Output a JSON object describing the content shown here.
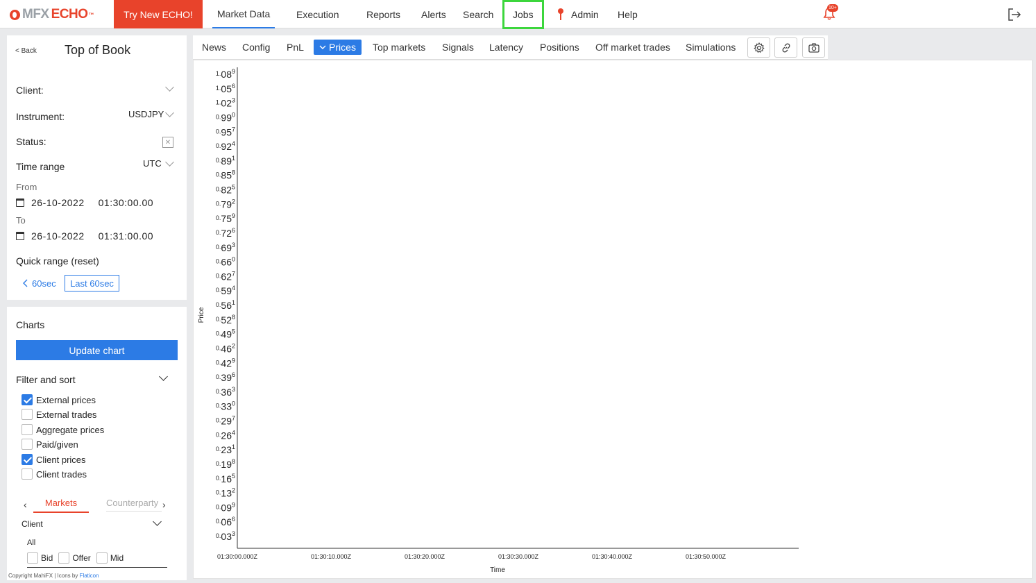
{
  "topbar": {
    "logo_mfx": "MFX",
    "logo_echo": "ECHO",
    "logo_tm": "™",
    "try_label": "Try New ECHO!",
    "nav": [
      "Market Data",
      "Execution",
      "Reports",
      "Alerts",
      "Search",
      "Jobs",
      "Admin",
      "Help"
    ],
    "notification_badge": "10+"
  },
  "left": {
    "back_label": "Back",
    "title": "Top of Book",
    "client_label": "Client:",
    "instrument_label": "Instrument:",
    "instrument_value": "USDJPY",
    "status_label": "Status:",
    "time_range_label": "Time range",
    "time_zone": "UTC",
    "from_label": "From",
    "from_date": "26-10-2022",
    "from_time": "01:30:00.00",
    "to_label": "To",
    "to_date": "26-10-2022",
    "to_time": "01:31:00.00",
    "quick_range_label": "Quick range (reset)",
    "prev_range": "60sec",
    "last_range": "Last 60sec",
    "charts_label": "Charts",
    "update_label": "Update chart",
    "filter_label": "Filter and sort",
    "filters": [
      {
        "label": "External prices",
        "checked": true
      },
      {
        "label": "External trades",
        "checked": false
      },
      {
        "label": "Aggregate prices",
        "checked": false
      },
      {
        "label": "Paid/given",
        "checked": false
      },
      {
        "label": "Client prices",
        "checked": true
      },
      {
        "label": "Client trades",
        "checked": false
      }
    ],
    "tab_markets": "Markets",
    "tab_counterparty": "Counterparty",
    "client_sub_label": "Client",
    "all_label": "All",
    "bid_label": "Bid",
    "offer_label": "Offer",
    "mid_label": "Mid",
    "copyright": "Copyright MahiFX | Icons by ",
    "copyright_link": "Flaticon"
  },
  "subnav": {
    "items": [
      "News",
      "Config",
      "PnL",
      "Prices",
      "Top markets",
      "Signals",
      "Latency",
      "Positions",
      "Off market trades",
      "Simulations"
    ]
  },
  "colors": {
    "accent": "#2c7be5",
    "brand": "#e8432b",
    "highlight": "#3cd63c"
  },
  "chart_data": {
    "type": "line",
    "title": "",
    "xlabel": "Time",
    "ylabel": "Price",
    "x_ticks": [
      "01:30:00.000Z",
      "01:30:10.000Z",
      "01:30:20.000Z",
      "01:30:30.000Z",
      "01:30:40.000Z",
      "01:30:50.000Z"
    ],
    "y_ticks": [
      {
        "main": "1.08",
        "sup": "9"
      },
      {
        "main": "1.05",
        "sup": "6"
      },
      {
        "main": "1.02",
        "sup": "3"
      },
      {
        "main": "0.99",
        "sup": "0"
      },
      {
        "main": "0.95",
        "sup": "7"
      },
      {
        "main": "0.92",
        "sup": "4"
      },
      {
        "main": "0.89",
        "sup": "1"
      },
      {
        "main": "0.85",
        "sup": "8"
      },
      {
        "main": "0.82",
        "sup": "5"
      },
      {
        "main": "0.79",
        "sup": "2"
      },
      {
        "main": "0.75",
        "sup": "9"
      },
      {
        "main": "0.72",
        "sup": "6"
      },
      {
        "main": "0.69",
        "sup": "3"
      },
      {
        "main": "0.66",
        "sup": "0"
      },
      {
        "main": "0.62",
        "sup": "7"
      },
      {
        "main": "0.59",
        "sup": "4"
      },
      {
        "main": "0.56",
        "sup": "1"
      },
      {
        "main": "0.52",
        "sup": "8"
      },
      {
        "main": "0.49",
        "sup": "5"
      },
      {
        "main": "0.46",
        "sup": "2"
      },
      {
        "main": "0.42",
        "sup": "9"
      },
      {
        "main": "0.39",
        "sup": "6"
      },
      {
        "main": "0.36",
        "sup": "3"
      },
      {
        "main": "0.33",
        "sup": "0"
      },
      {
        "main": "0.29",
        "sup": "7"
      },
      {
        "main": "0.26",
        "sup": "4"
      },
      {
        "main": "0.23",
        "sup": "1"
      },
      {
        "main": "0.19",
        "sup": "8"
      },
      {
        "main": "0.16",
        "sup": "5"
      },
      {
        "main": "0.13",
        "sup": "2"
      },
      {
        "main": "0.09",
        "sup": "9"
      },
      {
        "main": "0.06",
        "sup": "6"
      },
      {
        "main": "0.03",
        "sup": "3"
      }
    ],
    "series": [],
    "grid": false
  }
}
